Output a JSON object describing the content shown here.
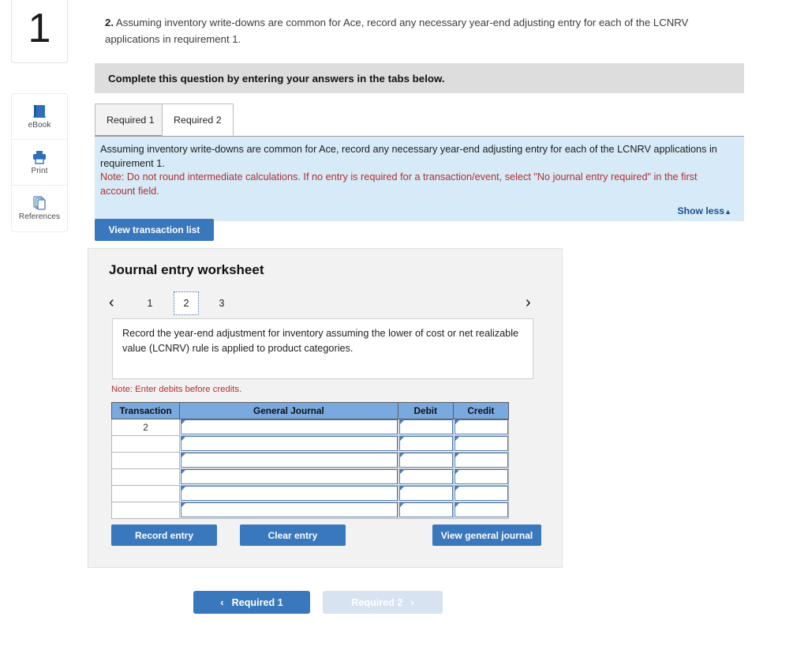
{
  "left_rail": {
    "question_number": "1",
    "tools": [
      {
        "label": "eBook",
        "icon": "ebook-icon"
      },
      {
        "label": "Print",
        "icon": "printer-icon"
      },
      {
        "label": "References",
        "icon": "references-icon"
      }
    ]
  },
  "requirement": {
    "number": "2.",
    "text": " Assuming inventory write-downs are common for Ace, record any necessary year-end adjusting entry for each of the LCNRV applications in requirement 1."
  },
  "banner": {
    "text": "Complete this question by entering your answers in the tabs below."
  },
  "tabs": [
    {
      "label": "Required 1",
      "active": false
    },
    {
      "label": "Required 2",
      "active": true
    }
  ],
  "instructions": {
    "line1": "Assuming inventory write-downs are common for Ace, record any necessary year-end adjusting entry for each of the LCNRV applications in requirement 1.",
    "note": "Note: Do not round intermediate calculations. If no entry is required for a transaction/event, select \"No journal entry required\" in the first account field.",
    "show_less_label": "Show less",
    "show_less_caret": "▲"
  },
  "view_transaction_list_label": "View transaction list",
  "worksheet": {
    "title": "Journal entry worksheet",
    "pager": {
      "prev_icon": "‹",
      "next_icon": "›",
      "pages": [
        "1",
        "2",
        "3"
      ],
      "selected": "2"
    },
    "scenario_text": "Record the year-end adjustment for inventory assuming the lower of cost or net realizable value (LCNRV) rule is applied to product categories.",
    "note": "Note: Enter debits before credits.",
    "table": {
      "headers": [
        "Transaction",
        "General Journal",
        "Debit",
        "Credit"
      ],
      "rows": [
        {
          "transaction": "2",
          "general_journal": "",
          "debit": "",
          "credit": ""
        },
        {
          "transaction": "",
          "general_journal": "",
          "debit": "",
          "credit": ""
        },
        {
          "transaction": "",
          "general_journal": "",
          "debit": "",
          "credit": ""
        },
        {
          "transaction": "",
          "general_journal": "",
          "debit": "",
          "credit": ""
        },
        {
          "transaction": "",
          "general_journal": "",
          "debit": "",
          "credit": ""
        },
        {
          "transaction": "",
          "general_journal": "",
          "debit": "",
          "credit": ""
        }
      ]
    },
    "buttons": {
      "record": "Record entry",
      "clear": "Clear entry",
      "view_general_journal": "View general journal"
    }
  },
  "bottom_nav": {
    "prev_label": "Required 1",
    "prev_chevron": "‹",
    "next_label": "Required 2",
    "next_chevron": "›"
  },
  "colors": {
    "accent_blue": "#3a78bd",
    "table_header_blue": "#7aa9e0",
    "panel_blue": "#d6eaf8",
    "banner_gray": "#dddddd",
    "note_red": "#b03030",
    "link_blue": "#1d4e8f",
    "disabled_blue": "#d7e3f1"
  }
}
